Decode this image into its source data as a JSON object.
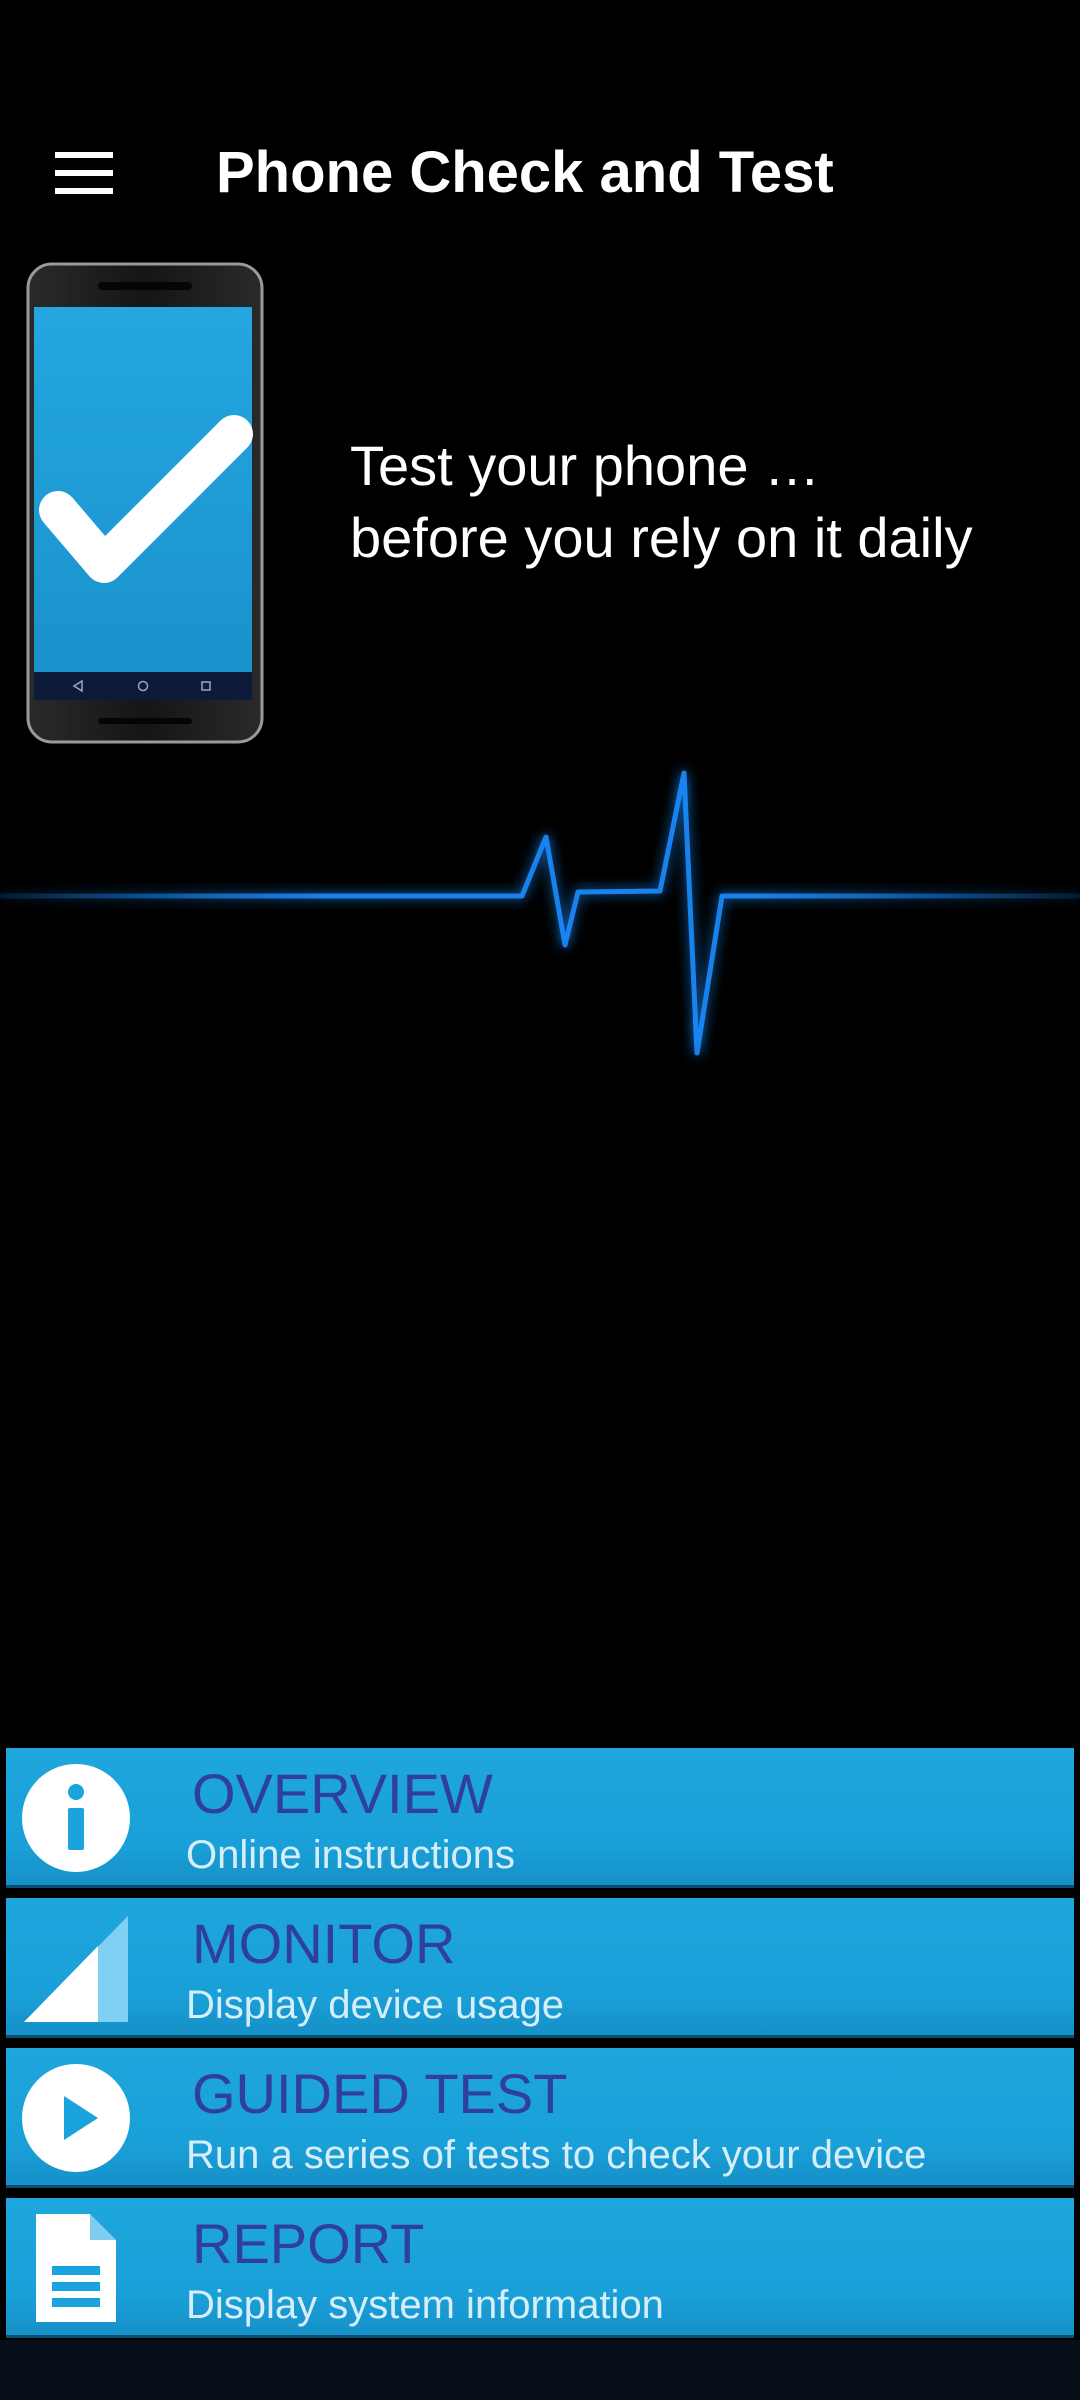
{
  "app": {
    "title": "Phone Check and Test"
  },
  "header": {
    "menu_icon": "hamburger-menu-icon"
  },
  "hero": {
    "tagline_line1": "Test your phone …",
    "tagline_line2": "before you rely on it daily",
    "illustration_icon": "phone-checkmark-icon"
  },
  "colors": {
    "accent": "#1aa3dc",
    "tile_title": "#2f3f9a",
    "pulse": "#1a8cff",
    "background": "#000000"
  },
  "menu": {
    "items": [
      {
        "title": "OVERVIEW",
        "subtitle": "Online instructions",
        "icon": "info-icon"
      },
      {
        "title": "MONITOR",
        "subtitle": "Display device usage",
        "icon": "signal-icon"
      },
      {
        "title": "GUIDED TEST",
        "subtitle": "Run a series of tests to check your device",
        "icon": "play-icon"
      },
      {
        "title": "REPORT",
        "subtitle": "Display system information",
        "icon": "document-icon"
      }
    ]
  }
}
